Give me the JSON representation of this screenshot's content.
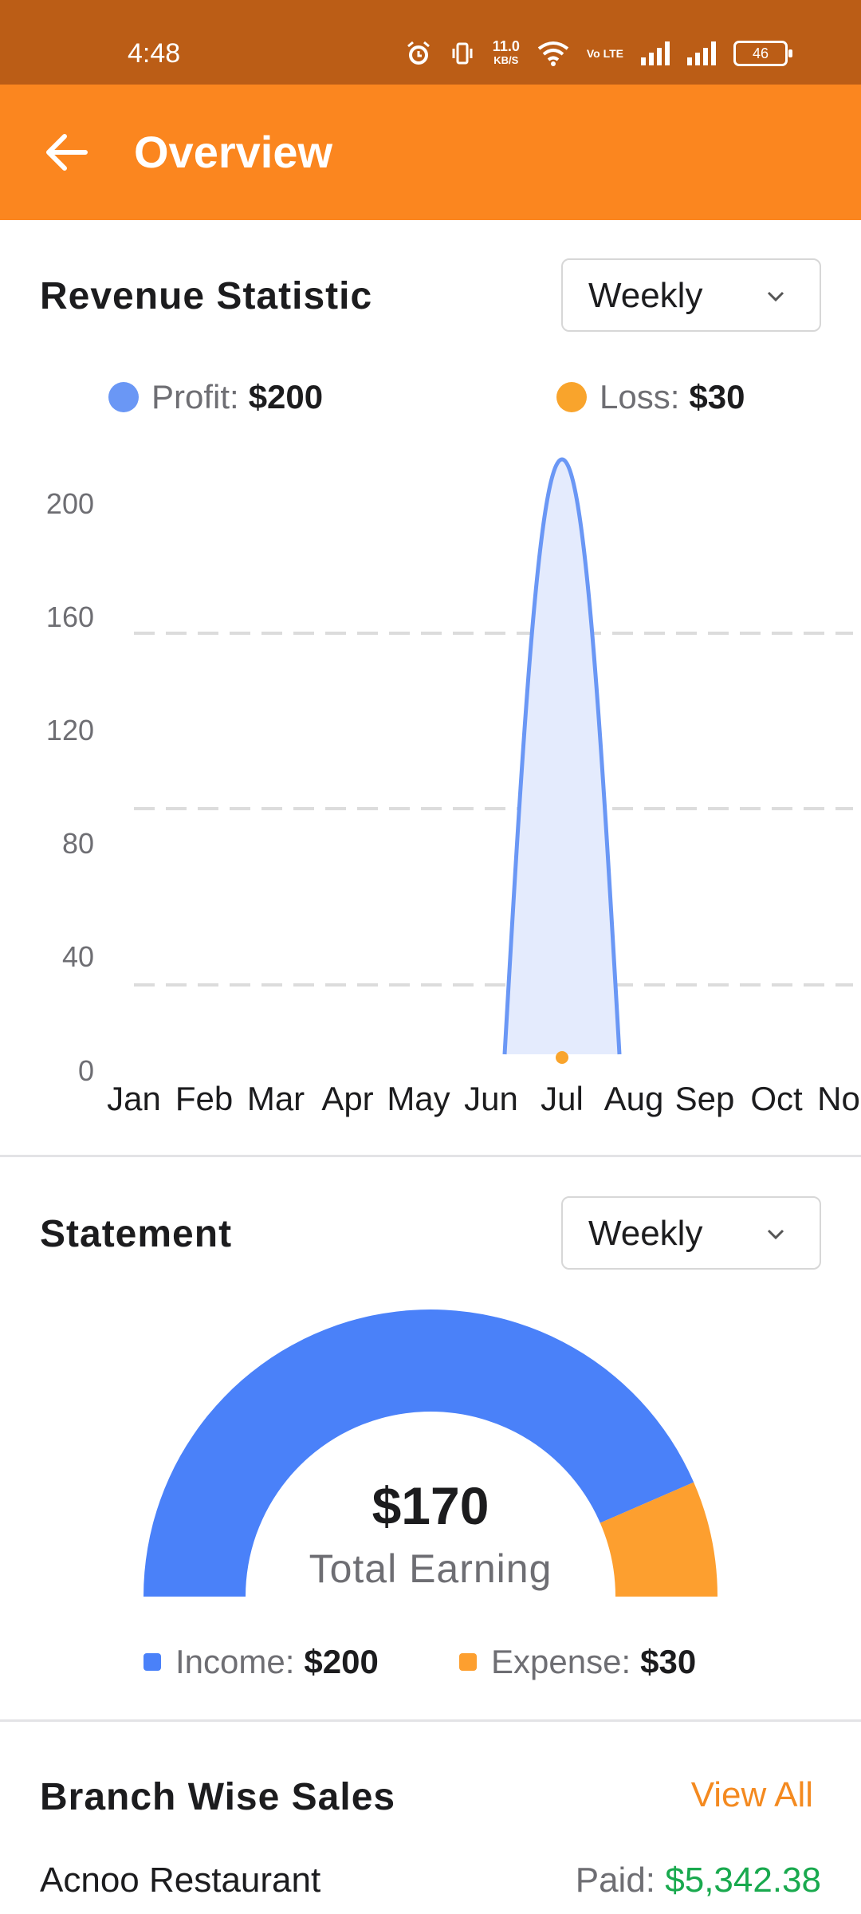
{
  "status_bar": {
    "time": "4:48",
    "net_speed": "11.0",
    "net_unit": "KB/S",
    "volte": "Vo LTE",
    "battery": "46"
  },
  "app_bar": {
    "title": "Overview"
  },
  "revenue": {
    "title": "Revenue Statistic",
    "period": "Weekly",
    "legend": [
      {
        "label": "Profit:",
        "value": "$200",
        "color": "#6a97f5"
      },
      {
        "label": "Loss:",
        "value": "$30",
        "color": "#f9a42c"
      }
    ]
  },
  "chart_data": {
    "type": "area",
    "title": "",
    "x": [
      "Jan",
      "Feb",
      "Mar",
      "Apr",
      "May",
      "Jun",
      "Jul",
      "Aug",
      "Sep",
      "Oct",
      "No"
    ],
    "y_ticks": [
      0,
      40,
      80,
      120,
      160,
      200
    ],
    "ylim": [
      0,
      200
    ],
    "grid": "dashed horizontal lines",
    "series": [
      {
        "name": "Profit",
        "color": "#6a97f5",
        "values": [
          0,
          0,
          0,
          0,
          0,
          0,
          200,
          0,
          0,
          0,
          0
        ]
      },
      {
        "name": "Loss",
        "color": "#f9a42c",
        "values": [
          0,
          0,
          0,
          0,
          0,
          0,
          0,
          0,
          0,
          0,
          0
        ]
      }
    ]
  },
  "statement": {
    "title": "Statement",
    "period": "Weekly",
    "total_amount": "$170",
    "total_label": "Total Earning",
    "income": {
      "label": "Income:",
      "value": "$200",
      "amount": 200,
      "color": "#4a81f9"
    },
    "expense": {
      "label": "Expense:",
      "value": "$30",
      "amount": 30,
      "color": "#fd9f2f"
    }
  },
  "branch_sales": {
    "title": "Branch Wise Sales",
    "view_all": "View All",
    "items": [
      {
        "name": "Acnoo Restaurant",
        "paid_label": "Paid:",
        "paid_value": "$5,342.38"
      }
    ]
  }
}
